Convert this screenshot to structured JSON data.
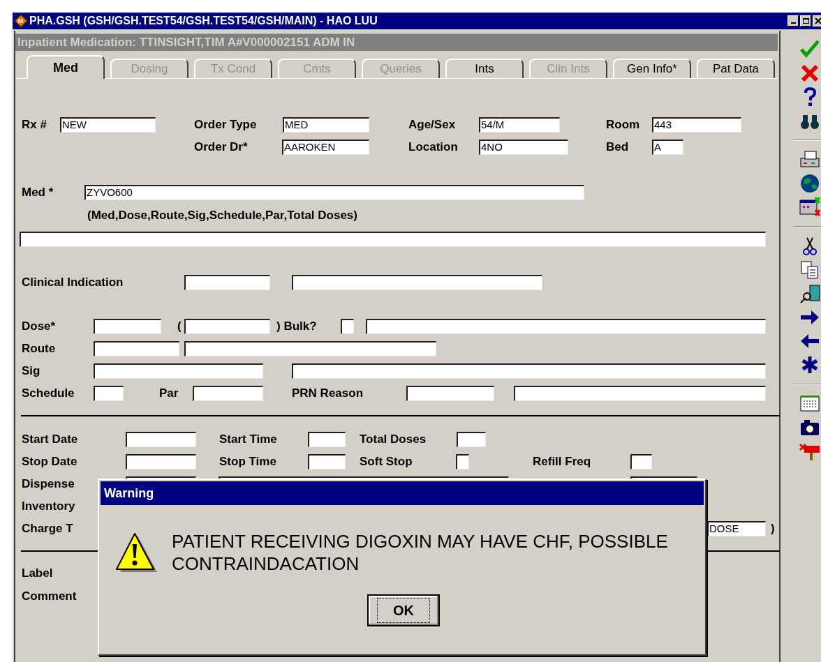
{
  "window": {
    "logo_letter": "M",
    "title": "PHA.GSH (GSH/GSH.TEST54/GSH.TEST54/GSH/MAIN) - HAO LUU"
  },
  "header": "Inpatient Medication:  TTINSIGHT,TIM A#V000002151 ADM IN",
  "tabs": [
    {
      "label": "Med",
      "selected": true,
      "disabled": false
    },
    {
      "label": "Dosing",
      "selected": false,
      "disabled": true
    },
    {
      "label": "Tx Cond",
      "selected": false,
      "disabled": true
    },
    {
      "label": "Cmts",
      "selected": false,
      "disabled": true
    },
    {
      "label": "Queries",
      "selected": false,
      "disabled": true
    },
    {
      "label": "Ints",
      "selected": false,
      "disabled": false
    },
    {
      "label": "Clin Ints",
      "selected": false,
      "disabled": true
    },
    {
      "label": "Gen Info*",
      "selected": false,
      "disabled": false
    },
    {
      "label": "Pat Data",
      "selected": false,
      "disabled": false
    }
  ],
  "form_rows": [
    {
      "items": [
        {
          "kind": "label",
          "text": "Rx #"
        },
        {
          "kind": "field",
          "value": "NEW"
        },
        {
          "kind": "label",
          "text": "Order Type"
        },
        {
          "kind": "field",
          "value": "MED"
        },
        {
          "kind": "label",
          "text": "Age/Sex"
        },
        {
          "kind": "field",
          "value": "54/M"
        },
        {
          "kind": "label",
          "text": "Room"
        },
        {
          "kind": "field",
          "value": "443"
        }
      ]
    },
    {
      "items": [
        {
          "kind": "label",
          "text": "Order Dr*"
        },
        {
          "kind": "field",
          "value": "AAROKEN"
        },
        {
          "kind": "label",
          "text": "Location"
        },
        {
          "kind": "field",
          "value": "4NO"
        },
        {
          "kind": "label",
          "text": "Bed"
        },
        {
          "kind": "field",
          "value": "A"
        }
      ]
    },
    {
      "items": [
        {
          "kind": "label",
          "text": "Med  *"
        },
        {
          "kind": "field",
          "value": "ZYVO600"
        }
      ]
    },
    {
      "items": [
        {
          "kind": "label",
          "text": "(Med,Dose,Route,Sig,Schedule,Par,Total Doses)"
        }
      ]
    },
    {
      "items": [
        {
          "kind": "field"
        }
      ]
    },
    {
      "items": [
        {
          "kind": "label",
          "text": "Clinical Indication"
        },
        {
          "kind": "field"
        },
        {
          "kind": "field"
        }
      ]
    },
    {
      "items": [
        {
          "kind": "label",
          "text": "Dose*"
        },
        {
          "kind": "field"
        },
        {
          "kind": "label",
          "text": "("
        },
        {
          "kind": "field"
        },
        {
          "kind": "label",
          "text": ") Bulk?"
        },
        {
          "kind": "check",
          "checked": false
        },
        {
          "kind": "field"
        }
      ]
    },
    {
      "items": [
        {
          "kind": "label",
          "text": "Route"
        },
        {
          "kind": "field"
        },
        {
          "kind": "field"
        }
      ]
    },
    {
      "items": [
        {
          "kind": "label",
          "text": "Sig"
        },
        {
          "kind": "field"
        },
        {
          "kind": "field"
        }
      ]
    },
    {
      "items": [
        {
          "kind": "label",
          "text": "Schedule"
        },
        {
          "kind": "field"
        },
        {
          "kind": "label",
          "text": "Par"
        },
        {
          "kind": "field"
        },
        {
          "kind": "label",
          "text": "PRN Reason"
        },
        {
          "kind": "field"
        },
        {
          "kind": "field"
        }
      ]
    },
    {
      "items": [
        {
          "kind": "rule"
        }
      ]
    },
    {
      "items": [
        {
          "kind": "label",
          "text": "Start Date"
        },
        {
          "kind": "field"
        },
        {
          "kind": "label",
          "text": "Start Time"
        },
        {
          "kind": "field"
        },
        {
          "kind": "label",
          "text": "Total Doses"
        },
        {
          "kind": "field"
        }
      ]
    },
    {
      "items": [
        {
          "kind": "label",
          "text": "Stop Date"
        },
        {
          "kind": "field"
        },
        {
          "kind": "label",
          "text": "Stop Time"
        },
        {
          "kind": "field"
        },
        {
          "kind": "label",
          "text": "Soft Stop"
        },
        {
          "kind": "check",
          "checked": false
        },
        {
          "kind": "label",
          "text": "Refill Freq"
        },
        {
          "kind": "field"
        }
      ]
    },
    {
      "items": [
        {
          "kind": "label",
          "text": "Dispense"
        },
        {
          "kind": "field"
        },
        {
          "kind": "field"
        },
        {
          "kind": "field"
        }
      ]
    },
    {
      "items": [
        {
          "kind": "label",
          "text": "Inventory"
        }
      ]
    },
    {
      "items": [
        {
          "kind": "label",
          "text": "Charge T"
        },
        {
          "kind": "field",
          "value": "DOSE"
        },
        {
          "kind": "label",
          "text": ")"
        }
      ]
    },
    {
      "items": [
        {
          "kind": "rule"
        }
      ]
    },
    {
      "items": [
        {
          "kind": "label",
          "text": "Label"
        }
      ]
    },
    {
      "items": [
        {
          "kind": "label",
          "text": "Comment"
        }
      ]
    }
  ],
  "dialog": {
    "title": "Warning",
    "message_lines": [
      "PATIENT RECEIVING DIGOXIN MAY HAVE CHF, POSSIBLE",
      "CONTRAINDACATION"
    ],
    "button": "OK"
  }
}
